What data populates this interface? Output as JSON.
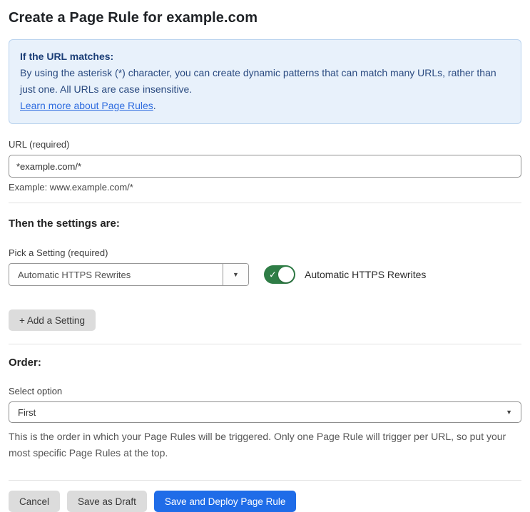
{
  "page": {
    "title": "Create a Page Rule for example.com"
  },
  "info_box": {
    "heading": "If the URL matches:",
    "body": "By using the asterisk (*) character, you can create dynamic patterns that can match many URLs, rather than just one. All URLs are case insensitive.",
    "link_label": "Learn more about Page Rules",
    "link_suffix": "."
  },
  "url_field": {
    "label": "URL (required)",
    "value": "*example.com/*",
    "helper": "Example: www.example.com/*"
  },
  "settings": {
    "heading": "Then the settings are:",
    "picker_label": "Pick a Setting (required)",
    "selected_setting": "Automatic HTTPS Rewrites",
    "dropdown_arrow": "▼",
    "toggle": {
      "state": "on",
      "check_glyph": "✓",
      "label": "Automatic HTTPS Rewrites"
    },
    "add_setting_label": "+ Add a Setting"
  },
  "order": {
    "heading": "Order:",
    "select_label": "Select option",
    "selected_option": "First",
    "select_arrow": "▼",
    "helper": "This is the order in which your Page Rules will be triggered. Only one Page Rule will trigger per URL, so put your most specific Page Rules at the top."
  },
  "footer": {
    "cancel_label": "Cancel",
    "save_draft_label": "Save as Draft",
    "deploy_label": "Save and Deploy Page Rule"
  },
  "colors": {
    "accent_blue": "#1f6ce8",
    "toggle_green": "#2f7d46",
    "info_background": "#e8f1fb",
    "info_border": "#bad3ee",
    "info_heading_text": "#1b3e77",
    "info_body_text": "#2a4a80",
    "link_blue": "#2d6bdf",
    "button_gray": "#dcdcdc"
  }
}
